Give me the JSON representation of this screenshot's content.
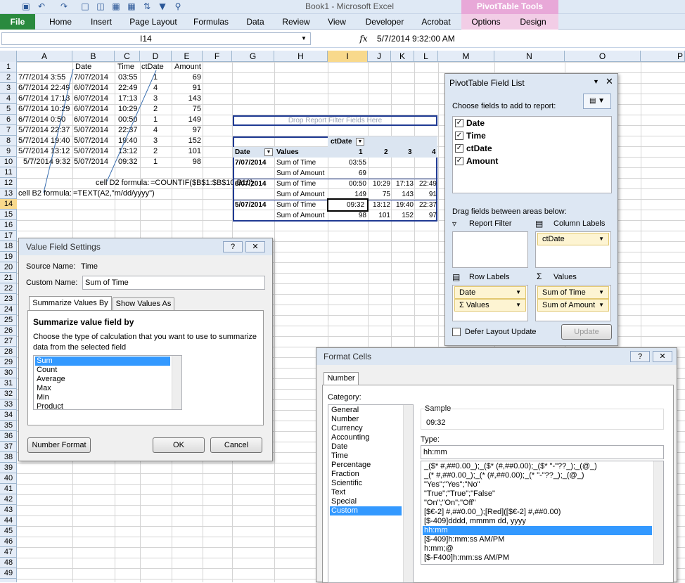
{
  "app": {
    "title": "Book1  -  Microsoft Excel",
    "pivot_tools": "PivotTable Tools"
  },
  "ribbon": {
    "file": "File",
    "tabs": [
      "Home",
      "Insert",
      "Page Layout",
      "Formulas",
      "Data",
      "Review",
      "View",
      "Developer",
      "Acrobat"
    ],
    "pivot_tabs": [
      "Options",
      "Design"
    ]
  },
  "formula_bar": {
    "name_box": "I14",
    "fx": "fx",
    "value": "5/7/2014  9:32:00 AM"
  },
  "columns": [
    "A",
    "B",
    "C",
    "D",
    "E",
    "F",
    "G",
    "H",
    "I",
    "J",
    "K",
    "L",
    "M",
    "N",
    "O",
    "P"
  ],
  "rows": [
    "1",
    "2",
    "3",
    "4",
    "5",
    "6",
    "7",
    "8",
    "9",
    "10",
    "11",
    "12",
    "13",
    "14",
    "15",
    "16",
    "17",
    "18",
    "19",
    "20",
    "21",
    "22",
    "23",
    "24",
    "25",
    "26",
    "27",
    "28",
    "29",
    "30",
    "31",
    "32",
    "33",
    "34",
    "35",
    "36",
    "37",
    "38",
    "39",
    "40",
    "41",
    "42",
    "43",
    "44",
    "45",
    "46",
    "47",
    "48",
    "49"
  ],
  "sheet": {
    "headers": [
      "Date",
      "Time",
      "ctDate",
      "Amount"
    ],
    "col_a": [
      "7/7/2014 3:55",
      "6/7/2014 22:49",
      "6/7/2014 17:13",
      "6/7/2014 10:29",
      "6/7/2014 0:50",
      "5/7/2014 22:37",
      "5/7/2014 19:40",
      "5/7/2014 13:12",
      "5/7/2014 9:32"
    ],
    "col_b": [
      "7/07/2014",
      "6/07/2014",
      "6/07/2014",
      "6/07/2014",
      "6/07/2014",
      "5/07/2014",
      "5/07/2014",
      "5/07/2014",
      "5/07/2014"
    ],
    "col_c": [
      "03:55",
      "22:49",
      "17:13",
      "10:29",
      "00:50",
      "22:37",
      "19:40",
      "13:12",
      "09:32"
    ],
    "col_d": [
      "1",
      "4",
      "3",
      "2",
      "1",
      "4",
      "3",
      "2",
      "1"
    ],
    "col_e": [
      "69",
      "91",
      "143",
      "75",
      "149",
      "97",
      "152",
      "101",
      "98"
    ],
    "note_d2_label": "cell D2 formula:",
    "note_d2_formula": "=COUNTIF($B$1:$B$10,B10)",
    "note_b2_label": "cell B2 formula:",
    "note_b2_formula": "=TEXT(A2,\"m/dd/yyyy\")"
  },
  "pivot": {
    "filter_drop": "Drop Report Filter Fields Here",
    "col_field": "ctDate",
    "row_field": "Date",
    "values_field": "Values",
    "col_items": [
      "1",
      "2",
      "3",
      "4"
    ],
    "rows": [
      {
        "date": "7/07/2014",
        "time_label": "Sum of Time",
        "time": [
          "03:55",
          "",
          "",
          ""
        ],
        "amt_label": "Sum of Amount",
        "amt": [
          "69",
          "",
          "",
          ""
        ]
      },
      {
        "date": "6/07/2014",
        "time_label": "Sum of Time",
        "time": [
          "00:50",
          "10:29",
          "17:13",
          "22:49"
        ],
        "amt_label": "Sum of Amount",
        "amt": [
          "149",
          "75",
          "143",
          "91"
        ]
      },
      {
        "date": "5/07/2014",
        "time_label": "Sum of Time",
        "time": [
          "09:32",
          "13:12",
          "19:40",
          "22:37"
        ],
        "amt_label": "Sum of Amount",
        "amt": [
          "98",
          "101",
          "152",
          "97"
        ]
      }
    ]
  },
  "field_list": {
    "title": "PivotTable Field List",
    "choose": "Choose fields to add to report:",
    "fields": [
      "Date",
      "Time",
      "ctDate",
      "Amount"
    ],
    "drag": "Drag fields between areas below:",
    "report_filter": "Report Filter",
    "column_labels": "Column Labels",
    "row_labels": "Row Labels",
    "values": "Values",
    "col_items": [
      "ctDate"
    ],
    "row_items": [
      "Date",
      "Values"
    ],
    "value_items": [
      "Sum of Time",
      "Sum of Amount"
    ],
    "defer": "Defer Layout Update",
    "update": "Update"
  },
  "vfs": {
    "title": "Value Field Settings",
    "source_label": "Source Name:",
    "source_value": "Time",
    "custom_label": "Custom Name:",
    "custom_value": "Sum of Time",
    "tabs": [
      "Summarize Values By",
      "Show Values As"
    ],
    "heading": "Summarize value field by",
    "desc1": "Choose the type of calculation that you want to use to summarize",
    "desc2": "data from the selected field",
    "list": [
      "Sum",
      "Count",
      "Average",
      "Max",
      "Min",
      "Product"
    ],
    "number_format": "Number Format",
    "ok": "OK",
    "cancel": "Cancel"
  },
  "fc": {
    "title": "Format Cells",
    "tab": "Number",
    "category_label": "Category:",
    "categories": [
      "General",
      "Number",
      "Currency",
      "Accounting",
      "Date",
      "Time",
      "Percentage",
      "Fraction",
      "Scientific",
      "Text",
      "Special",
      "Custom"
    ],
    "sample_label": "Sample",
    "sample_value": "09:32",
    "type_label": "Type:",
    "type_value": "hh:mm",
    "formats": [
      "_($* #,##0.00_);_($* (#,##0.00);_($* \"-\"??_);_(@_)",
      "_(* #,##0.00_);_(* (#,##0.00);_(* \"-\"??_);_(@_)",
      "\"Yes\";\"Yes\";\"No\"",
      "\"True\";\"True\";\"False\"",
      "\"On\";\"On\";\"Off\"",
      "[$€-2] #,##0.00_);[Red]([$€-2] #,##0.00)",
      "[$-409]dddd, mmmm dd, yyyy",
      "hh:mm",
      "[$-409]h:mm:ss AM/PM",
      "h:mm;@",
      "[$-F400]h:mm:ss AM/PM"
    ]
  }
}
